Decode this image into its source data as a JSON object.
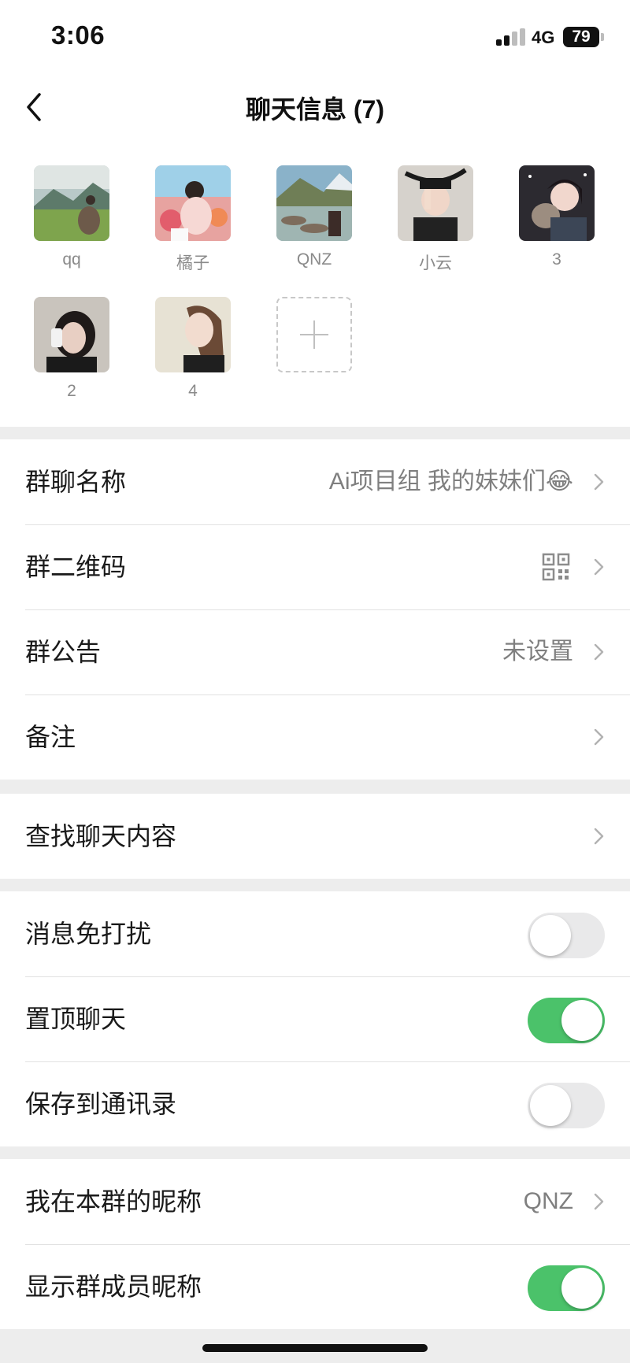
{
  "status_bar": {
    "time": "3:06",
    "network": "4G",
    "battery": "79"
  },
  "nav": {
    "title": "聊天信息 (7)",
    "back_icon": "chevron-left-icon"
  },
  "members": [
    {
      "name": "qq"
    },
    {
      "name": "橘子"
    },
    {
      "name": "QNZ"
    },
    {
      "name": "小云"
    },
    {
      "name": "3"
    },
    {
      "name": "2"
    },
    {
      "name": "4"
    }
  ],
  "add_member_icon": "plus-icon",
  "group_info": {
    "name_label": "群聊名称",
    "name_value": "Ai项目组 我的妹妹们😂",
    "qr_label": "群二维码",
    "qr_icon": "qr-code-icon",
    "notice_label": "群公告",
    "notice_value": "未设置",
    "remark_label": "备注"
  },
  "search": {
    "label": "查找聊天内容"
  },
  "toggles": {
    "mute_label": "消息免打扰",
    "mute_on": false,
    "pin_label": "置顶聊天",
    "pin_on": true,
    "save_label": "保存到通讯录",
    "save_on": false
  },
  "nickname": {
    "my_nickname_label": "我在本群的昵称",
    "my_nickname_value": "QNZ",
    "show_nicknames_label": "显示群成员昵称",
    "show_nicknames_on": true
  },
  "colors": {
    "accent_green": "#4bc26a",
    "background": "#ededed"
  }
}
